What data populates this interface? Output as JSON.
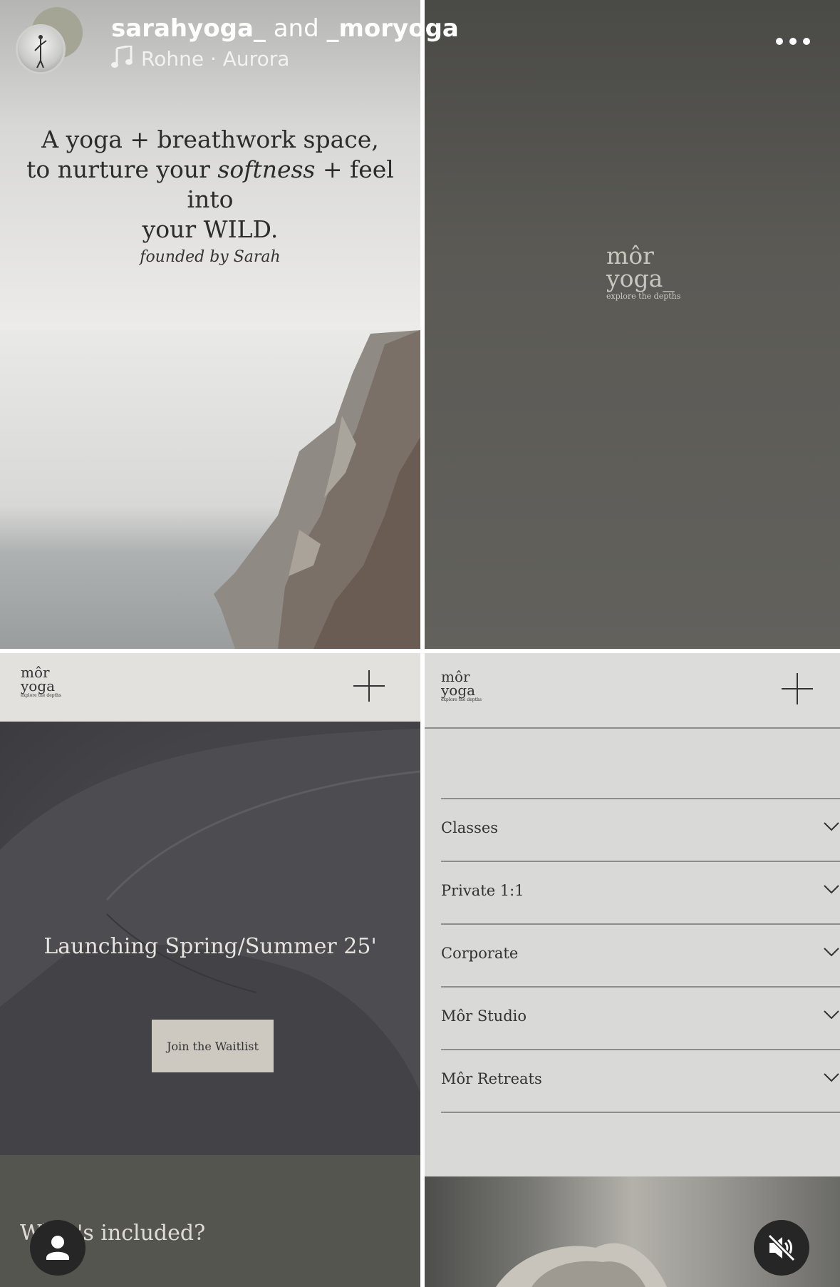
{
  "story_header": {
    "user_primary": "sarahyoga_",
    "conjunction": "and",
    "user_secondary": "_moryoga",
    "song_artist": "Rohne",
    "song_separator": "·",
    "song_title": "Aurora"
  },
  "panel_intro": {
    "tagline_line1": "A yoga + breathwork space,",
    "tagline_line2_pre": "to nurture your ",
    "tagline_line2_em": "softness",
    "tagline_line2_post": " + feel into",
    "tagline_line3": "your WILD.",
    "founded": "founded by Sarah"
  },
  "panel_logo": {
    "line1": "môr",
    "line2": "yoga_",
    "tagline": "explore the depths"
  },
  "panel_launch": {
    "logo_line1": "môr",
    "logo_line2": "yoga",
    "logo_tagline": "explore the depths",
    "headline": "Launching Spring/Summer 25'",
    "cta_label": "Join the Waitlist",
    "section_heading": "What's included?"
  },
  "panel_menu": {
    "logo_line1": "môr",
    "logo_line2": "yoga",
    "logo_tagline": "explore the depths",
    "items": [
      {
        "label": "Classes"
      },
      {
        "label": "Private 1:1"
      },
      {
        "label": "Corporate"
      },
      {
        "label": "Môr Studio"
      },
      {
        "label": "Môr Retreats"
      }
    ]
  },
  "icons": {
    "music": "music-note-icon",
    "more": "more-options-icon",
    "profile": "person-icon",
    "mute": "muted-speaker-icon",
    "expand": "plus-icon",
    "chevron": "chevron-down-icon"
  }
}
